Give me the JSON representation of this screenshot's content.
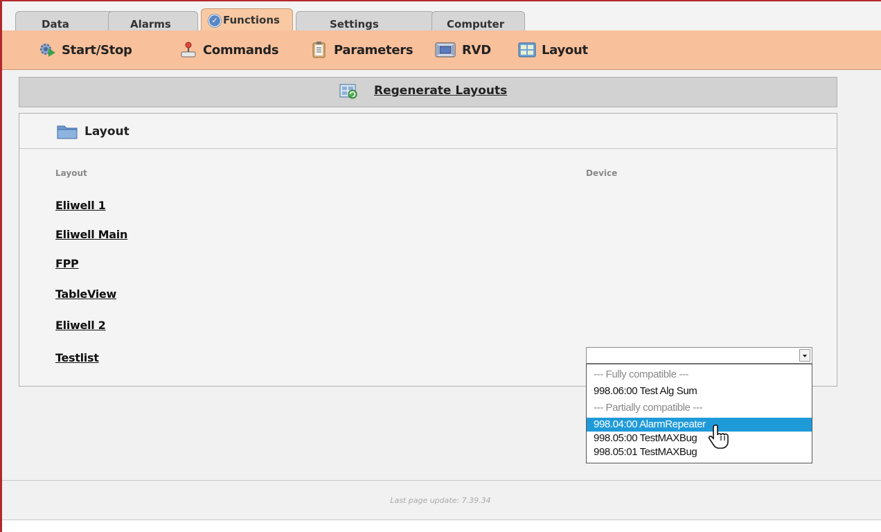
{
  "tabs": [
    {
      "label": "Data",
      "active": false
    },
    {
      "label": "Alarms",
      "active": false
    },
    {
      "label": "Functions",
      "active": true
    },
    {
      "label": "Settings",
      "active": false
    },
    {
      "label": "Computer",
      "active": false
    }
  ],
  "toolbar": {
    "items": [
      {
        "label": "Start/Stop",
        "icon": "start-stop-icon"
      },
      {
        "label": "Commands",
        "icon": "joystick-icon"
      },
      {
        "label": "Parameters",
        "icon": "clipboard-icon"
      },
      {
        "label": "RVD",
        "icon": "monitor-icon"
      },
      {
        "label": "Layout",
        "icon": "layout-grid-icon"
      }
    ]
  },
  "regenerate": {
    "label": "Regenerate Layouts",
    "icon": "regenerate-icon"
  },
  "panel": {
    "title": "Layout",
    "col_layout": "Layout",
    "col_device": "Device",
    "rows": [
      "Eliwell 1",
      "Eliwell Main",
      "FPP",
      "TableView",
      "Eliwell 2",
      "Testlist"
    ]
  },
  "dropdown": {
    "selected": "",
    "options": [
      {
        "label": "--- Fully compatible ---",
        "group": true
      },
      {
        "label": "998.06:00 Test Alg Sum",
        "group": false
      },
      {
        "label": "--- Partially compatible ---",
        "group": true
      },
      {
        "label": "998.04:00 AlarmRepeater",
        "group": false,
        "highlighted": true
      },
      {
        "label": "998.05:00 TestMAXBug",
        "group": false
      },
      {
        "label": "998.05:01 TestMAXBug",
        "group": false
      }
    ]
  },
  "footer": {
    "text": "Last page update: 7.39.34"
  },
  "colors": {
    "accent_orange": "#f8c09b",
    "frame_red": "#b3282d",
    "highlight_blue": "#1f9ad9"
  }
}
